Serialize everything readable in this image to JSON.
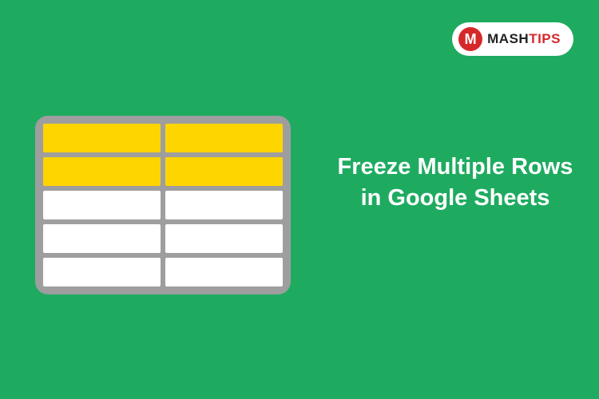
{
  "logo": {
    "icon_letter": "M",
    "text_main": "MASH",
    "text_accent": "TIPS"
  },
  "title": "Freeze Multiple Rows in Google Sheets",
  "sheet": {
    "rows": 5,
    "cols": 2,
    "frozen_rows": 2
  }
}
